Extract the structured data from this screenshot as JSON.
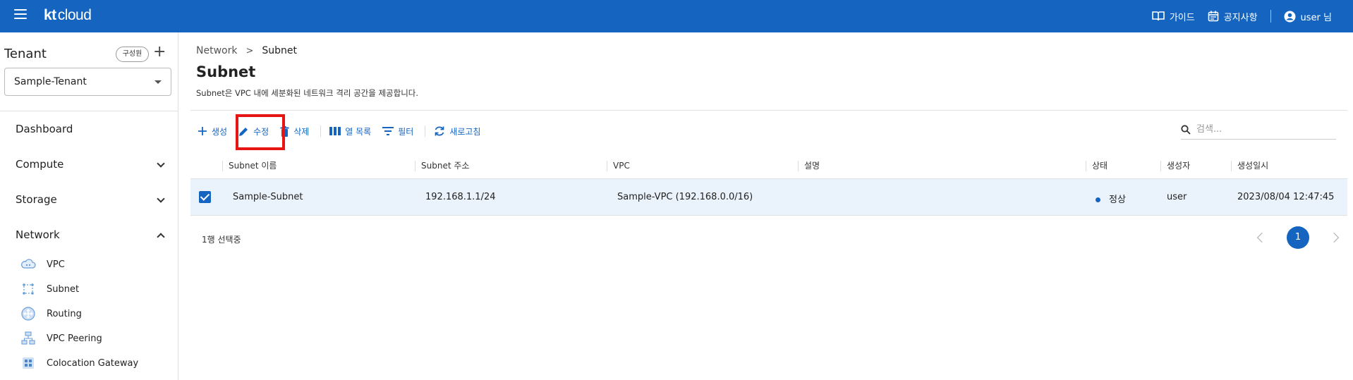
{
  "header": {
    "logo_kt": "kt",
    "logo_cloud": "cloud",
    "guide_label": "가이드",
    "notice_label": "공지사항",
    "user_label": "user 님"
  },
  "sidebar": {
    "tenant_title": "Tenant",
    "member_button": "구성원",
    "add_label": "+",
    "tenant_selected": "Sample-Tenant",
    "nav": [
      {
        "label": "Dashboard"
      },
      {
        "label": "Compute"
      },
      {
        "label": "Storage"
      },
      {
        "label": "Network"
      }
    ],
    "network_items": [
      {
        "label": "VPC"
      },
      {
        "label": "Subnet"
      },
      {
        "label": "Routing"
      },
      {
        "label": "VPC Peering"
      },
      {
        "label": "Colocation Gateway"
      }
    ]
  },
  "breadcrumb": {
    "parent": "Network",
    "separator": ">",
    "current": "Subnet"
  },
  "page": {
    "title": "Subnet",
    "description": "Subnet은 VPC 내에 세분화된 네트워크 격리 공간을 제공합니다."
  },
  "toolbar": {
    "create_label": "생성",
    "edit_label": "수정",
    "delete_label": "삭제",
    "columns_label": "열 목록",
    "filter_label": "필터",
    "refresh_label": "새로고침"
  },
  "search": {
    "placeholder": "검색..."
  },
  "table": {
    "columns": [
      "Subnet 이름",
      "Subnet 주소",
      "VPC",
      "설명",
      "상태",
      "생성자",
      "생성일시"
    ],
    "rows": [
      {
        "name": "Sample-Subnet",
        "address": "192.168.1.1/24",
        "vpc": "Sample-VPC (192.168.0.0/16)",
        "description": "",
        "status": "정상",
        "creator": "user",
        "created_at": "2023/08/04 12:47:45",
        "checked": true
      }
    ]
  },
  "footer": {
    "selected_text": "1행 선택중",
    "current_page": "1"
  },
  "colors": {
    "brand": "#1565c0",
    "highlight": "#e81515",
    "selected_row": "#eaf2fb"
  }
}
